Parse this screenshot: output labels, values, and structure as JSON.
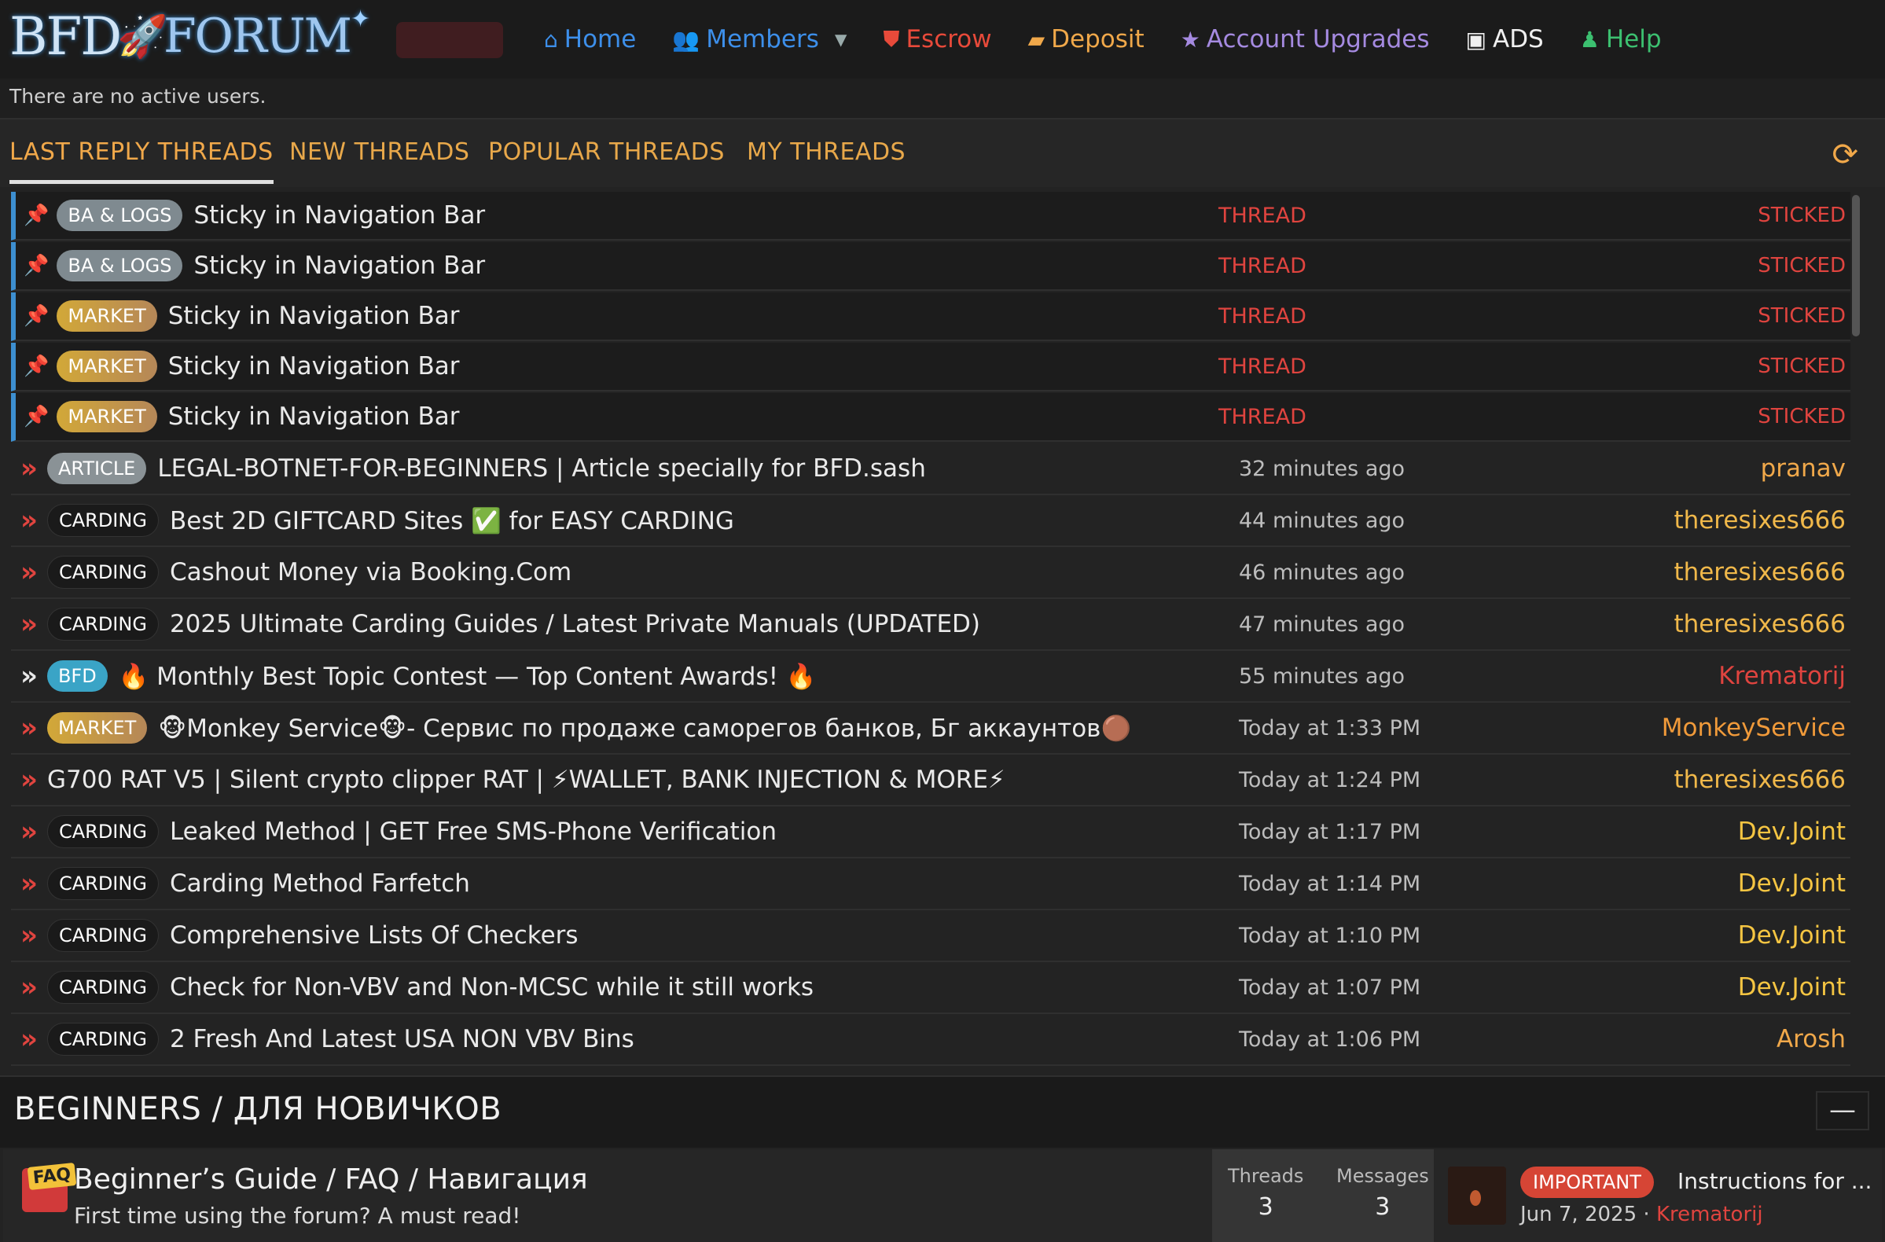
{
  "logo": {
    "text_a": "BFD",
    "text_b": "FORUM"
  },
  "nav": [
    {
      "label": "Home",
      "icon": "home-icon",
      "color": "#3d8fea"
    },
    {
      "label": "Members",
      "icon": "users-icon",
      "color": "#3d8fea"
    },
    {
      "label": "Escrow",
      "icon": "shield-icon",
      "color": "#e84a3a"
    },
    {
      "label": "Deposit",
      "icon": "wallet-icon",
      "color": "#f0a84a"
    },
    {
      "label": "Account Upgrades",
      "icon": "star-icon",
      "color": "#a58ae0"
    },
    {
      "label": "ADS",
      "icon": "ad-icon",
      "color": "#f0f0f0"
    },
    {
      "label": "Help",
      "icon": "user-help-icon",
      "color": "#3cc070"
    }
  ],
  "active_users": "There are no active users.",
  "tabs": [
    "LAST REPLY THREADS",
    "NEW THREADS",
    "POPULAR THREADS",
    "MY THREADS"
  ],
  "sticky": [
    {
      "prefix": "BA & LOGS",
      "kind": "ba",
      "title": "Sticky in Navigation Bar",
      "type": "THREAD",
      "status": "STICKED"
    },
    {
      "prefix": "BA & LOGS",
      "kind": "ba",
      "title": "Sticky in Navigation Bar",
      "type": "THREAD",
      "status": "STICKED"
    },
    {
      "prefix": "MARKET",
      "kind": "market",
      "title": "Sticky in Navigation Bar",
      "type": "THREAD",
      "status": "STICKED"
    },
    {
      "prefix": "MARKET",
      "kind": "market",
      "title": "Sticky in Navigation Bar",
      "type": "THREAD",
      "status": "STICKED"
    },
    {
      "prefix": "MARKET",
      "kind": "market",
      "title": "Sticky in Navigation Bar",
      "type": "THREAD",
      "status": "STICKED"
    }
  ],
  "threads": [
    {
      "prefix": "ARTICLE",
      "kind": "article",
      "title": "LEGAL-BOTNET-FOR-BEGINNERS | Article specially for BFD.sash",
      "time": "32 minutes ago",
      "user": "pranav",
      "user_color": "#f0a84a"
    },
    {
      "prefix": "CARDING",
      "kind": "carding",
      "title": "Best 2D GIFTCARD Sites ✅ for EASY CARDING",
      "time": "44 minutes ago",
      "user": "theresixes666",
      "user_color": "#f0b84a"
    },
    {
      "prefix": "CARDING",
      "kind": "carding",
      "title": "Cashout Money via Booking.Com",
      "time": "46 minutes ago",
      "user": "theresixes666",
      "user_color": "#f0b84a"
    },
    {
      "prefix": "CARDING",
      "kind": "carding",
      "title": "2025 Ultimate Carding Guides / Latest Private Manuals (UPDATED)",
      "time": "47 minutes ago",
      "user": "theresixes666",
      "user_color": "#f0b84a"
    },
    {
      "prefix": "BFD",
      "kind": "bfd",
      "title": "🔥 Monthly Best Topic Contest — Top Content Awards! 🔥",
      "time": "55 minutes ago",
      "user": "Krematorij",
      "user_color": "#e0443f",
      "white_arrow": true
    },
    {
      "prefix": "MARKET",
      "kind": "market",
      "title": "🐵Monkey Service🐵- Сервис по продаже саморегов банков, Бг аккаунтов🟤",
      "time": "Today at 1:33 PM",
      "user": "MonkeyService",
      "user_color": "#f09a3a"
    },
    {
      "prefix": "",
      "kind": "",
      "title": "G700 RAT V5 | Silent crypto clipper RAT | ⚡WALLET, BANK INJECTION & MORE⚡",
      "time": "Today at 1:24 PM",
      "user": "theresixes666",
      "user_color": "#f0b84a"
    },
    {
      "prefix": "CARDING",
      "kind": "carding",
      "title": "Leaked Method | GET Free SMS-Phone Verification",
      "time": "Today at 1:17 PM",
      "user": "Dev.Joint",
      "user_color": "#f5c542"
    },
    {
      "prefix": "CARDING",
      "kind": "carding",
      "title": "Carding Method Farfetch",
      "time": "Today at 1:14 PM",
      "user": "Dev.Joint",
      "user_color": "#f5c542"
    },
    {
      "prefix": "CARDING",
      "kind": "carding",
      "title": "Comprehensive Lists Of Checkers",
      "time": "Today at 1:10 PM",
      "user": "Dev.Joint",
      "user_color": "#f5c542"
    },
    {
      "prefix": "CARDING",
      "kind": "carding",
      "title": "Check for Non-VBV and Non-MCSC while it still works",
      "time": "Today at 1:07 PM",
      "user": "Dev.Joint",
      "user_color": "#f5c542"
    },
    {
      "prefix": "CARDING",
      "kind": "carding",
      "title": "2 Fresh And Latest USA NON VBV Bins",
      "time": "Today at 1:06 PM",
      "user": "Arosh",
      "user_color": "#f0a84a"
    }
  ],
  "section": {
    "title": "BEGINNERS / ДЛЯ НОВИЧКОВ",
    "collapse": "—"
  },
  "forum": {
    "icon_text": "FAQ",
    "name": "Beginner’s Guide / FAQ / Навигация",
    "desc": "First time using the forum? A must read!",
    "threads_label": "Threads",
    "threads": "3",
    "messages_label": "Messages",
    "messages": "3",
    "last_badge": "IMPORTANT",
    "last_title": "Instructions for ...",
    "last_date": "Jun 7, 2025",
    "last_sep": "·",
    "last_user": "Krematorij"
  }
}
